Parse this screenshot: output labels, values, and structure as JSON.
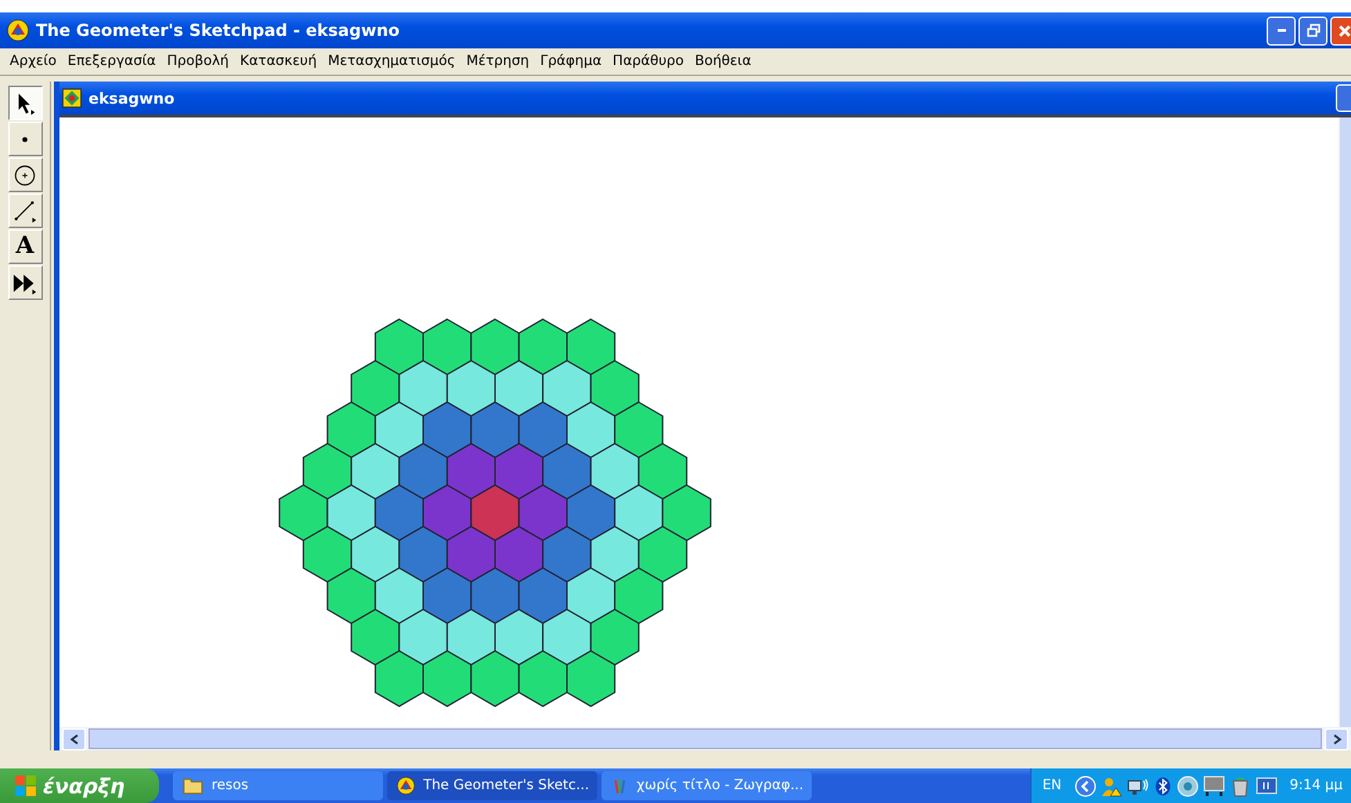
{
  "window": {
    "title": "The Geometer's Sketchpad - eksagwno"
  },
  "menu": [
    "Αρχείο",
    "Επεξεργασία",
    "Προβολή",
    "Κατασκευή",
    "Μετασχηματισμός",
    "Μέτρηση",
    "Γράφημα",
    "Παράθυρο",
    "Βοήθεια"
  ],
  "tools": [
    {
      "kind": "arrow",
      "selected": true
    },
    {
      "kind": "point",
      "selected": false
    },
    {
      "kind": "compass",
      "selected": false
    },
    {
      "kind": "line",
      "selected": false
    },
    {
      "kind": "text",
      "glyph": "A",
      "selected": false
    },
    {
      "kind": "custom",
      "selected": false
    }
  ],
  "document": {
    "title": "eksagwno"
  },
  "figure": {
    "rings": [
      {
        "color": "#cc3355"
      },
      {
        "color": "#7b35cc"
      },
      {
        "color": "#3377cc"
      },
      {
        "color": "#77e8dd"
      },
      {
        "color": "#22dd77"
      }
    ]
  },
  "taskbar": {
    "start": "έναρξη",
    "tasks": [
      {
        "kind": "folder",
        "label": "resos",
        "selected": false
      },
      {
        "kind": "sketchpad",
        "label": "The Geometer's Sketc...",
        "selected": true
      },
      {
        "kind": "paint",
        "label": "χωρίς τίτλο - Ζωγραφ...",
        "selected": false
      }
    ],
    "language": "EN",
    "clock": "9:14 μμ"
  }
}
